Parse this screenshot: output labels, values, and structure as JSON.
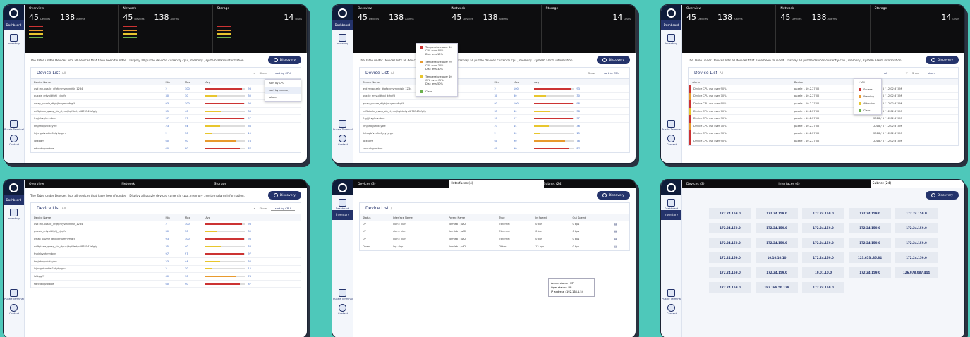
{
  "common": {
    "dashboard": "Dashboard",
    "inventory": "Inventory",
    "terminal": "Puzzle Terminal",
    "contact": "Contact",
    "desc": "The Table under Devices lists all devices that have been founded . Display all puzzle devices currently cpu , memory , system alarm information.",
    "discovery": "Discovery",
    "show": "Show",
    "overview": "Overview",
    "network": "Network",
    "storage": "Storage",
    "n45": "45",
    "n138": "138",
    "n14": "14",
    "devices": "Devices",
    "alarms": "Alarms",
    "disks": "Disks",
    "device_list": "Device List",
    "all": "All",
    "slash": "/",
    "sort_cpu": "sort by CPU",
    "sort_mem": "sort by memory",
    "alarm": "alarm"
  },
  "device_table": {
    "headers": [
      "Device Name",
      "Min",
      "Max",
      "Avg"
    ],
    "rows": [
      {
        "name": "asd my.puzzle_dfgfgrvyvmvndsk_1234",
        "min": "2",
        "max": "100",
        "avg": "93"
      },
      {
        "name": "puzzle_ertyuidfghj_kjhgfd",
        "min": "30",
        "max": "30",
        "avg": "30"
      },
      {
        "name": "qwap_puzzle_dfghjkruymnvfsgf4",
        "min": "93",
        "max": "100",
        "avg": "98"
      },
      {
        "name": "edftpizzle_qwap_sio_rtyusijhgfdsrtyui876543sfgfg",
        "min": "35",
        "max": "40",
        "avg": "38"
      },
      {
        "name": "fhgjrjkvghnvdbvn",
        "min": "97",
        "max": "97",
        "avg": "97"
      },
      {
        "name": "kmjnhbgvfcdxytre",
        "min": "23",
        "max": "44",
        "avg": "36"
      },
      {
        "name": "lkjhngbfvcdfet1ytytyrgtn",
        "min": "2",
        "max": "30",
        "avg": "15"
      },
      {
        "name": "lotkpgfff",
        "min": "60",
        "max": "90",
        "avg": "78"
      },
      {
        "name": "sdrcutbgvarboe",
        "min": "60",
        "max": "90",
        "avg": "87"
      }
    ]
  },
  "filter_menu": [
    {
      "label": "Temperature over 60",
      "lines": [
        "CPU over 90%",
        "Disk less 10%"
      ],
      "color": "#c33"
    },
    {
      "label": "Temperature over 70",
      "lines": [
        "CPU over 70%",
        "Disk less 30%"
      ],
      "color": "#e89a2e"
    },
    {
      "label": "Temperature over 40",
      "lines": [
        "CPU over 45%",
        "Disk less 50%"
      ],
      "color": "#e8c62e"
    },
    {
      "label": "Clear",
      "lines": [],
      "color": "#6ab04c"
    }
  ],
  "alarm_menu": [
    "All",
    "Severe",
    "Warning",
    "Attention",
    "Clear"
  ],
  "alarm_table": {
    "headers": [
      "Alarm",
      "Device",
      "Time"
    ],
    "rows": [
      {
        "alarm": "Device CPU use over 90%",
        "device": "puzzle 1 10.2.27.02",
        "time": "2018 / 6 / 12 02:37AM"
      },
      {
        "alarm": "Device CPU use over 70%",
        "device": "puzzle 1 10.2.27.02",
        "time": "2018 / 6 / 12 02:37AM"
      },
      {
        "alarm": "Device CPU use over 90%",
        "device": "puzzle 1 10.2.27.02",
        "time": "2018 / 6 / 12 02:37AM"
      },
      {
        "alarm": "Device CPU use over 70%",
        "device": "puzzle 1 10.2.27.02",
        "time": "2018 / 6 / 12 02:37AM"
      },
      {
        "alarm": "Device CPU use over 90%",
        "device": "puzzle 1 10.2.27.02",
        "time": "2018 / 6 / 12 02:37AM"
      },
      {
        "alarm": "Device CPU use over 70%",
        "device": "puzzle 1 10.2.27.02",
        "time": "2018 / 6 / 12 02:37AM"
      },
      {
        "alarm": "Device CPU use over 90%",
        "device": "puzzle 1 10.2.27.02",
        "time": "2018 / 6 / 12 02:37AM"
      },
      {
        "alarm": "Device CPU use over 90%",
        "device": "puzzle 1 10.2.27.02",
        "time": "2018 / 6 / 12 02:37AM"
      }
    ]
  },
  "inventory": {
    "tabs": [
      "Devices (3)",
      "Interfaces (4)",
      "Subnet (24)"
    ],
    "headers": [
      "Status",
      "Interface Name",
      "Parent Name",
      "Type",
      "In Speed",
      "Out Speed"
    ],
    "rows": [
      {
        "status": "UP",
        "name": "vian : vian",
        "parent": "ilomlab : pzf2",
        "type": "Ethernet",
        "in": "0 bps",
        "out": "0 bps"
      },
      {
        "status": "UP",
        "name": "vian : vian",
        "parent": "ilomlab : pzf2",
        "type": "Ethernet",
        "in": "0 bps",
        "out": "0 bps"
      },
      {
        "status": "UP",
        "name": "vian : vian",
        "parent": "ilomlab : pzf2",
        "type": "Ethernet",
        "in": "0 bps",
        "out": "0 bps"
      },
      {
        "status": "Down",
        "name": "lap : lap",
        "parent": "ilomlab : pzf2",
        "type": "Other",
        "in": "12 bps",
        "out": "0 bps"
      }
    ],
    "popup": [
      "Admin status : UP",
      "Oper status : UP",
      "IP address : 192.168.1.54"
    ]
  },
  "subnets": [
    "172.24.159.0",
    "172.24.159.0",
    "172.24.159.0",
    "172.24.159.0",
    "172.24.159.0",
    "172.24.159.0",
    "172.24.159.0",
    "172.24.159.0",
    "172.24.159.0",
    "172.24.159.0",
    "172.24.159.0",
    "172.24.159.0",
    "172.24.159.0",
    "172.24.159.0",
    "172.24.159.0",
    "172.24.159.0",
    "10.10.10.10",
    "172.24.159.0",
    "123.653..85.84",
    "172.24.159.0",
    "172.24.159.0",
    "172.24.159.0",
    "10.01.10.0",
    "172.24.159.0",
    "126.078.087.444",
    "172.24.159.0",
    "192.168.50.128",
    "172.24.159.0"
  ]
}
